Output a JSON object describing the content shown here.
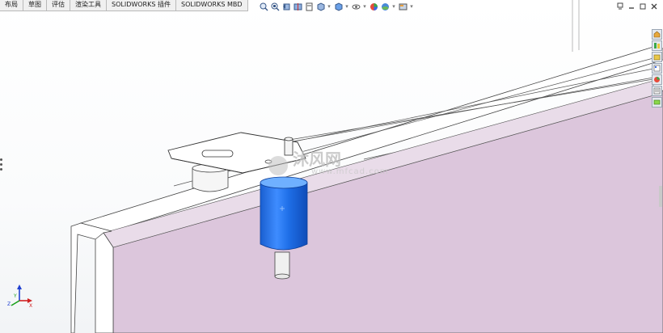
{
  "tabs": [
    "布局",
    "草图",
    "评估",
    "渲染工具",
    "SOLIDWORKS 插件",
    "SOLIDWORKS MBD"
  ],
  "hud_icons": [
    "zoom-to-fit-icon",
    "zoom-area-icon",
    "previous-view-icon",
    "section-view-icon",
    "dynamic-annotation-icon",
    "view-orientation-icon",
    "display-style-icon",
    "hide-show-items-icon",
    "edit-appearance-icon",
    "apply-scene-icon",
    "view-settings-icon"
  ],
  "window_controls": [
    "restore-icon",
    "minimize-icon",
    "maximize-icon",
    "close-icon"
  ],
  "task_pane_icons": [
    "resources-icon",
    "design-library-icon",
    "file-explorer-icon",
    "view-palette-icon",
    "appearances-icon",
    "custom-properties-icon"
  ],
  "watermark": {
    "logo_text": "沐风网",
    "url_text": "www.mfcad.com"
  },
  "triad": {
    "x_label": "X",
    "y_label": "Y",
    "z_label": "Z"
  },
  "colors": {
    "panel_face": "#dcc6dc",
    "cylinder_body": "#1f6fe8",
    "cylinder_highlight": "#6fb0ff",
    "rail": "#ffffff",
    "edge": "#333333",
    "tab_bar": "#f0f0f0"
  }
}
